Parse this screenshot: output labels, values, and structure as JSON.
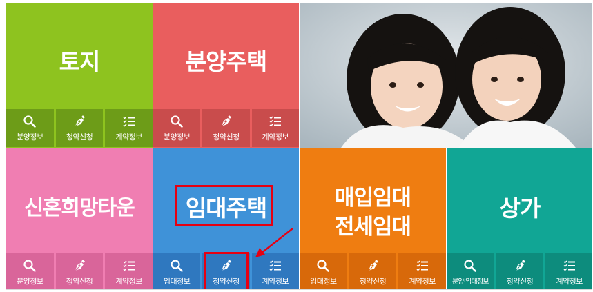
{
  "tiles": {
    "land": {
      "title": "토지",
      "buttons": [
        "분양정보",
        "청약신청",
        "계약정보"
      ]
    },
    "sale_housing": {
      "title": "분양주택",
      "buttons": [
        "분양정보",
        "청약신청",
        "계약정보"
      ]
    },
    "newlywed": {
      "title": "신혼희망타운",
      "buttons": [
        "분양정보",
        "청약신청",
        "계약정보"
      ]
    },
    "rental_housing": {
      "title": "임대주택",
      "buttons": [
        "임대정보",
        "청약신청",
        "계약정보"
      ]
    },
    "purchase_rental": {
      "title_line1": "매입임대",
      "title_line2": "전세임대",
      "buttons": [
        "임대정보",
        "청약신청",
        "계약정보"
      ]
    },
    "shop": {
      "title": "상가",
      "buttons": [
        "분양·임대정보",
        "청약신청",
        "계약정보"
      ]
    }
  },
  "icons": [
    "search-icon",
    "pen-nib-icon",
    "checklist-icon"
  ],
  "colors": {
    "land": "#8ec31f",
    "sale_housing": "#e95e5e",
    "newlywed": "#f07eb2",
    "rental_housing": "#3f92d8",
    "purchase_rental": "#ef7d11",
    "shop": "#11a695",
    "highlight": "#e60012"
  }
}
